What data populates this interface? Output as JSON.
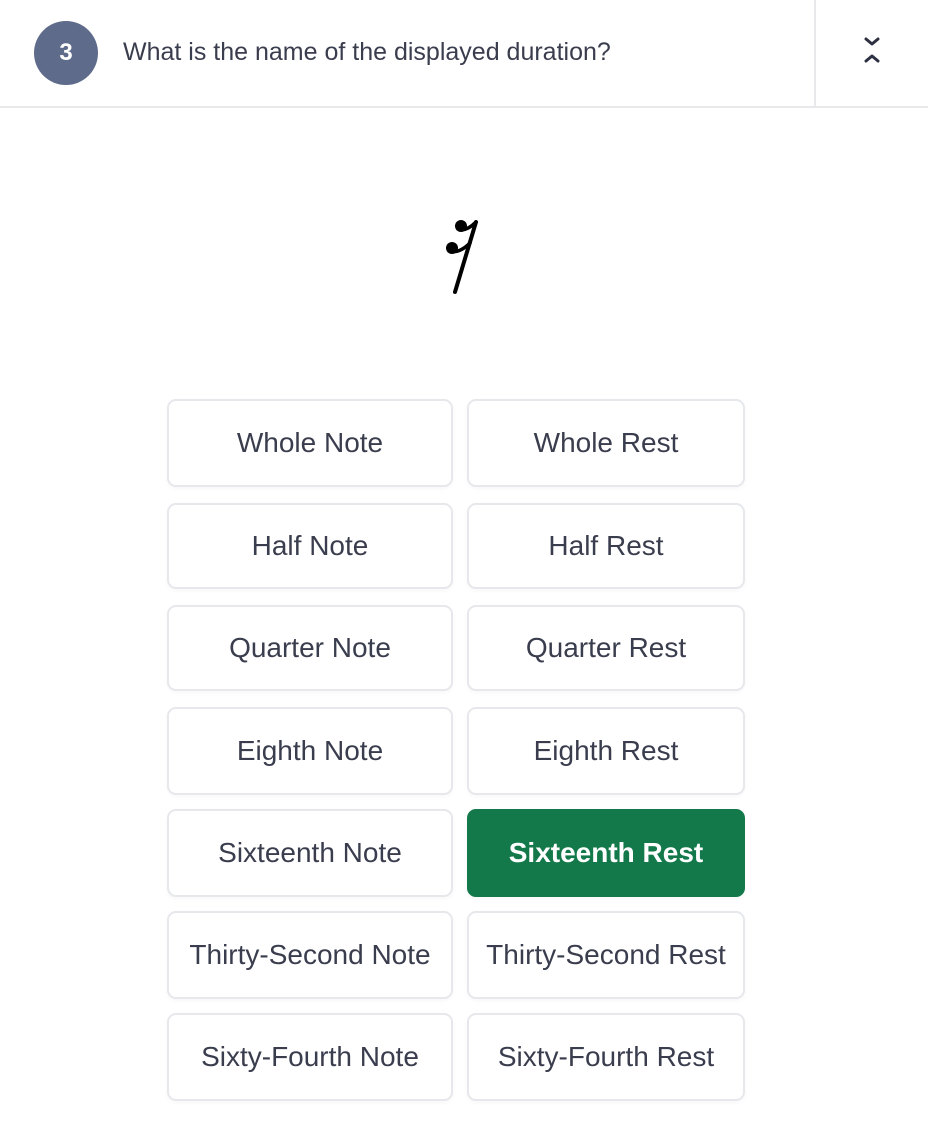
{
  "question": {
    "number": "3",
    "text": "What is the name of the displayed duration?"
  },
  "header": {
    "toggle_icon": "collapse-chevrons-icon"
  },
  "symbol": {
    "icon": "sixteenth-rest-icon"
  },
  "colors": {
    "badge": "#5f6b8a",
    "selected": "#14794a",
    "border": "#e7e8ec",
    "text": "#3a3d4d"
  },
  "answers": [
    {
      "label": "Whole Note",
      "selected": false
    },
    {
      "label": "Whole Rest",
      "selected": false
    },
    {
      "label": "Half Note",
      "selected": false
    },
    {
      "label": "Half Rest",
      "selected": false
    },
    {
      "label": "Quarter Note",
      "selected": false
    },
    {
      "label": "Quarter Rest",
      "selected": false
    },
    {
      "label": "Eighth Note",
      "selected": false
    },
    {
      "label": "Eighth Rest",
      "selected": false
    },
    {
      "label": "Sixteenth Note",
      "selected": false
    },
    {
      "label": "Sixteenth Rest",
      "selected": true
    },
    {
      "label": "Thirty-Second Note",
      "selected": false
    },
    {
      "label": "Thirty-Second Rest",
      "selected": false
    },
    {
      "label": "Sixty-Fourth Note",
      "selected": false
    },
    {
      "label": "Sixty-Fourth Rest",
      "selected": false
    }
  ]
}
